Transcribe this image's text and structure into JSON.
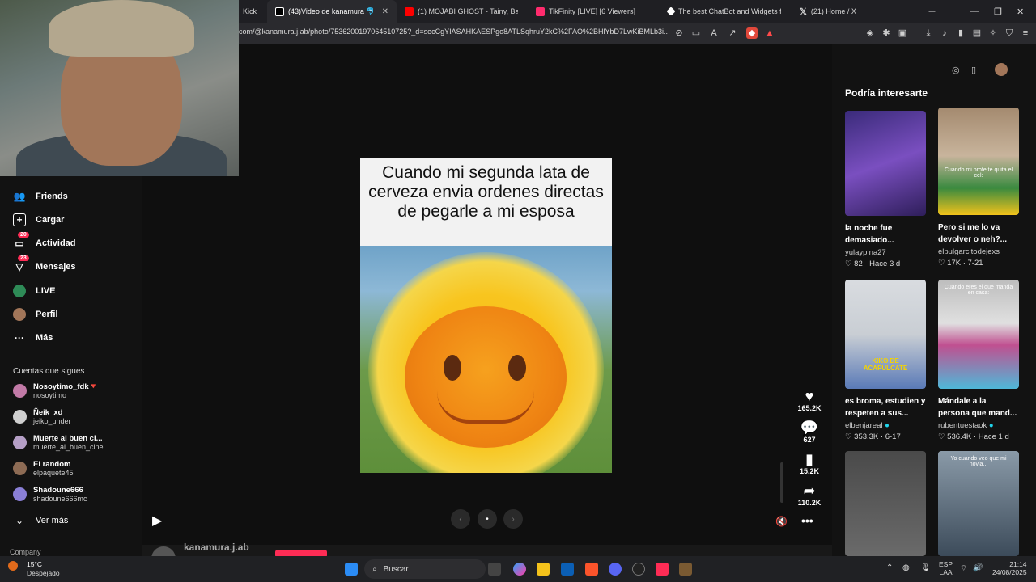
{
  "browser": {
    "tabs": [
      {
        "label": "Kick",
        "icon": "kick-icon",
        "color": "#53fc18",
        "active": false
      },
      {
        "label": "(43)Video de kanamura 🐬 (",
        "icon": "tiktok-icon",
        "color": "#ffffff",
        "active": true
      },
      {
        "label": "(1) MOJABI GHOST - Tainy, Bad Bun",
        "icon": "youtube-icon",
        "color": "#ff0000",
        "active": false
      },
      {
        "label": "TikFinity [LIVE] [6 Viewers]",
        "icon": "tikfinity-icon",
        "color": "#ff2b6d",
        "active": false
      },
      {
        "label": "The best ChatBot and Widgets for K",
        "icon": "diamond-icon",
        "color": "#ffffff",
        "active": false
      },
      {
        "label": "(21) Home / X",
        "icon": "x-icon",
        "color": "#ffffff",
        "active": false
      }
    ],
    "url": "com/@kanamura.j.ab/photo/7536200197064510725?_d=secCgYIASAHKAESPgo8ATLSqhruY2kC%2FAO%2BHlYbD7LwKiBMLb3i..."
  },
  "sidebar": {
    "nav": [
      {
        "label": "Friends",
        "icon": "friends-icon",
        "badge": ""
      },
      {
        "label": "Cargar",
        "icon": "upload-icon",
        "badge": ""
      },
      {
        "label": "Actividad",
        "icon": "activity-icon",
        "badge": "20"
      },
      {
        "label": "Mensajes",
        "icon": "messages-icon",
        "badge": "23"
      },
      {
        "label": "LIVE",
        "icon": "live-icon",
        "badge": ""
      },
      {
        "label": "Perfil",
        "icon": "profile-icon",
        "badge": ""
      },
      {
        "label": "Más",
        "icon": "more-icon",
        "badge": ""
      }
    ],
    "following_header": "Cuentas que sigues",
    "following": [
      {
        "name": "Nosoytimo_fdk🔻",
        "handle": "nosoytimo",
        "color": "#c27aa7"
      },
      {
        "name": "Ñeik_xd",
        "handle": "jeiko_under",
        "color": "#cfcfcf"
      },
      {
        "name": "Muerte al buen ci...",
        "handle": "muerte_al_buen_cine",
        "color": "#b59fc6"
      },
      {
        "name": "El random",
        "handle": "elpaquete45",
        "color": "#8d6b54"
      },
      {
        "name": "Shadoune666",
        "handle": "shadoune666mc",
        "color": "#8a7fd6"
      }
    ],
    "see_more": "Ver más",
    "company": "Company"
  },
  "post": {
    "caption": "Cuando mi segunda lata de cerveza envia ordenes directas de pegarle a mi esposa",
    "author": "kanamura.j.ab",
    "actions": [
      {
        "icon": "heart-icon",
        "count": "165.2K"
      },
      {
        "icon": "comment-icon",
        "count": "627"
      },
      {
        "icon": "bookmark-icon",
        "count": "15.2K"
      },
      {
        "icon": "share-icon",
        "count": "110.2K"
      }
    ]
  },
  "suggestions": {
    "title": "Podría interesarte",
    "items": [
      {
        "title": "la noche fue demasiado...",
        "author": "yulaypina27",
        "stats": "82 · Hace 3 d",
        "verified": false,
        "thumb_text": ""
      },
      {
        "title": "Pero si me lo va devolver o neh?...",
        "author": "elpulgarcitodejexs",
        "stats": "17K · 7-21",
        "verified": false,
        "thumb_text": "Cuando mi profe te quita el cel:"
      },
      {
        "title": "es broma, estudien y respeten a sus...",
        "author": "elbenjareal",
        "stats": "353.3K · 6-17",
        "verified": true,
        "thumb_text": "KIKO DE ACAPULCATE"
      },
      {
        "title": "Mándale a la persona que mand...",
        "author": "rubentuestaok",
        "stats": "536.4K · Hace 1 d",
        "verified": true,
        "thumb_text": "Cuando eres el que manda en casa:"
      },
      {
        "title": "",
        "author": "",
        "stats": "",
        "verified": false,
        "thumb_text": ""
      },
      {
        "title": "",
        "author": "",
        "stats": "",
        "verified": false,
        "thumb_text": "Yo cuando veo que mi novia..."
      }
    ]
  },
  "taskbar": {
    "weather_temp": "15°C",
    "weather_desc": "Despejado",
    "search_label": "Buscar",
    "lang1": "ESP",
    "lang2": "LAA",
    "time": "21:14",
    "date": "24/08/2025"
  }
}
